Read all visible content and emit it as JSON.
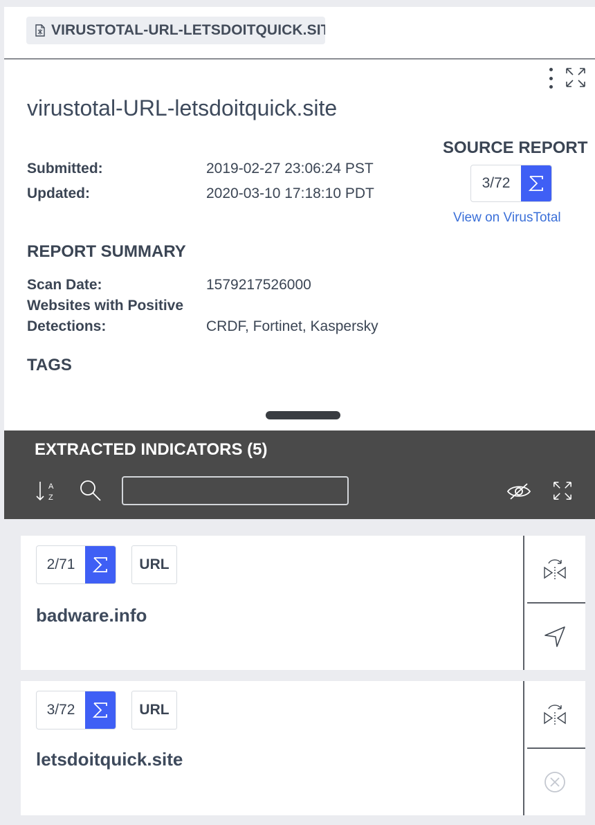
{
  "tab": {
    "label": "VIRUSTOTAL-URL-LETSDOITQUICK.SITE"
  },
  "report": {
    "title": "virustotal-URL-letsdoitquick.site",
    "submitted_label": "Submitted:",
    "submitted_value": "2019-02-27 23:06:24 PST",
    "updated_label": "Updated:",
    "updated_value": "2020-03-10 17:18:10 PDT"
  },
  "source_report": {
    "title": "SOURCE REPORT",
    "score": "3/72",
    "link": "View on VirusTotal"
  },
  "summary": {
    "title": "REPORT SUMMARY",
    "scan_date_label": "Scan Date:",
    "scan_date_value": "1579217526000",
    "positives_label_line1": "Websites with Positive",
    "positives_label_line2": "Detections:",
    "positives_value": "CRDF, Fortinet, Kaspersky"
  },
  "tags": {
    "title": "TAGS"
  },
  "indicators": {
    "title": "EXTRACTED INDICATORS (5)",
    "search_placeholder": "",
    "items": [
      {
        "score": "2/71",
        "type": "URL",
        "value": "badware.info",
        "secondary_action": "navigate-icon"
      },
      {
        "score": "3/72",
        "type": "URL",
        "value": "letsdoitquick.site",
        "secondary_action": "close-circle-icon"
      }
    ]
  },
  "colors": {
    "accent": "#3f5ff5",
    "dark_bar": "#4a4a4a",
    "link": "#3a6fd8",
    "background": "#ebecf0"
  }
}
